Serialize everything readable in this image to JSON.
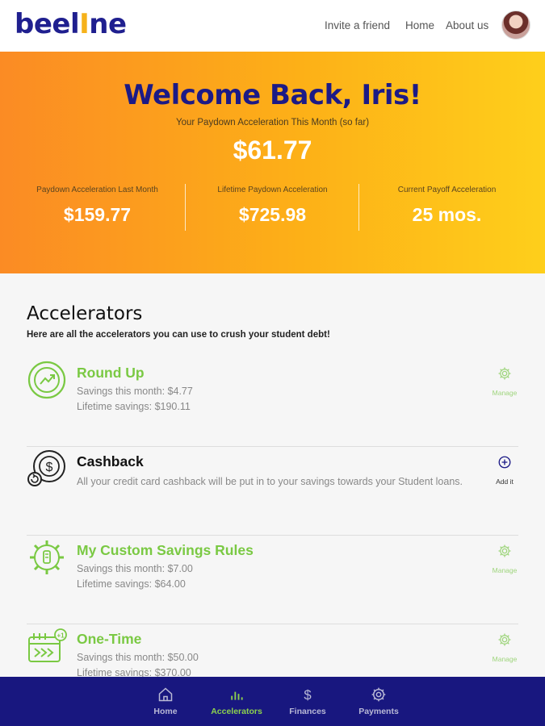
{
  "header": {
    "logo_main": "beel",
    "logo_accent": "I",
    "logo_end": "ne",
    "nav": [
      "Invite a friend",
      "Home",
      "About us"
    ]
  },
  "hero": {
    "title": "Welcome Back, Iris!",
    "subtitle": "Your Paydown Acceleration This Month (so far)",
    "amount": "$61.77",
    "stats": [
      {
        "label": "Paydown Acceleration Last Month",
        "value": "$159.77"
      },
      {
        "label": "Lifetime Paydown Acceleration",
        "value": "$725.98"
      },
      {
        "label": "Current Payoff Acceleration",
        "value": "25 mos."
      }
    ]
  },
  "accelerators": {
    "title": "Accelerators",
    "subtitle": "Here are all the accelerators you can use to crush your student debt!",
    "items": [
      {
        "name": "Round Up",
        "line1": "Savings this month: $4.77",
        "line2": "Lifetime savings: $190.11",
        "action": "Manage",
        "icon": "round-up-icon"
      },
      {
        "name": "Cashback",
        "desc": "All your credit card cashback will be put in to your savings towards your Student loans.",
        "action": "Add it",
        "icon": "cashback-icon"
      },
      {
        "name": "My Custom Savings Rules",
        "line1": "Savings this month: $7.00",
        "line2": "Lifetime savings: $64.00",
        "action": "Manage",
        "icon": "custom-rules-icon"
      },
      {
        "name": "One-Time",
        "line1": "Savings this month: $50.00",
        "line2": "Lifetime savings: $370.00",
        "action": "Manage",
        "icon": "one-time-icon"
      }
    ]
  },
  "bottom_nav": {
    "tabs": [
      {
        "label": "Home",
        "icon": "home-icon"
      },
      {
        "label": "Accelerators",
        "icon": "bar-chart-icon",
        "active": true
      },
      {
        "label": "Finances",
        "icon": "dollar-icon"
      },
      {
        "label": "Payments",
        "icon": "gear-icon"
      }
    ]
  },
  "colors": {
    "brand_navy": "#1c1a86",
    "accent_green": "#7ac943",
    "hero_orange": "#fb8b24",
    "hero_yellow": "#fecf1b"
  }
}
